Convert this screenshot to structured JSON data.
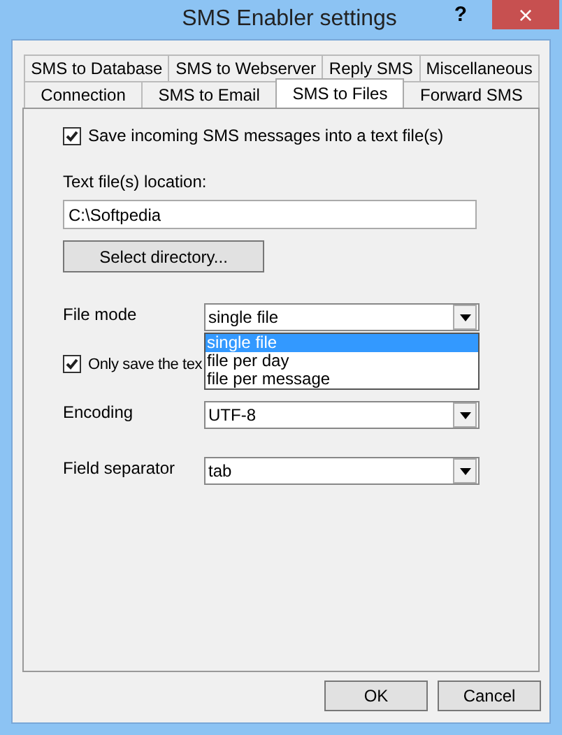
{
  "window": {
    "title": "SMS Enabler settings",
    "help": "?",
    "close": "×"
  },
  "tab_rows": [
    [
      {
        "label": "SMS to Database",
        "selected": false
      },
      {
        "label": "SMS to Webserver",
        "selected": false
      },
      {
        "label": "Reply SMS",
        "selected": false
      },
      {
        "label": "Miscellaneous",
        "selected": false
      }
    ],
    [
      {
        "label": "Connection",
        "selected": false
      },
      {
        "label": "SMS to Email",
        "selected": false
      },
      {
        "label": "SMS to Files",
        "selected": true
      },
      {
        "label": "Forward SMS",
        "selected": false
      }
    ]
  ],
  "save_checkbox": {
    "label": "Save incoming SMS messages into a text file(s)",
    "checked": true
  },
  "location": {
    "label": "Text file(s) location:",
    "value": "C:\\Softpedia"
  },
  "select_button": "Select directory...",
  "file_mode": {
    "label": "File mode",
    "value": "single file",
    "expanded": true,
    "options": [
      {
        "label": "single file",
        "selected": true
      },
      {
        "label": "file per day",
        "selected": false
      },
      {
        "label": "file per message",
        "selected": false
      }
    ]
  },
  "only_checkbox": {
    "label": "Only save the tex",
    "checked": true
  },
  "encoding": {
    "label": "Encoding",
    "value": "UTF-8"
  },
  "separator": {
    "label": "Field separator",
    "value": "tab"
  },
  "buttons": [
    "OK",
    "Cancel"
  ]
}
